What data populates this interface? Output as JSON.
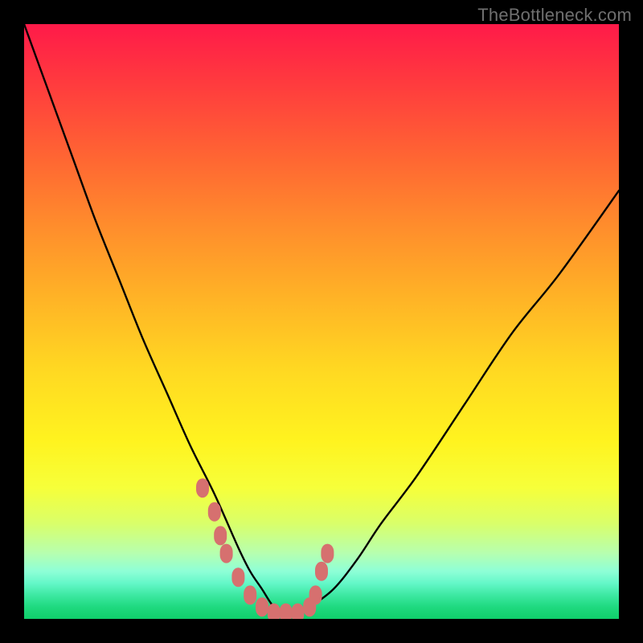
{
  "watermark": "TheBottleneck.com",
  "colors": {
    "page_bg": "#000000",
    "curve": "#000000",
    "marker": "#d6706f",
    "gradient_top": "#ff1a49",
    "gradient_bottom": "#10cf6b"
  },
  "chart_data": {
    "type": "line",
    "title": "",
    "xlabel": "",
    "ylabel": "",
    "xlim": [
      0,
      100
    ],
    "ylim": [
      0,
      100
    ],
    "grid": false,
    "legend": false,
    "series": [
      {
        "name": "bottleneck-curve",
        "x": [
          0,
          4,
          8,
          12,
          16,
          20,
          24,
          28,
          32,
          36,
          38,
          40,
          42,
          44,
          46,
          48,
          52,
          56,
          60,
          66,
          74,
          82,
          90,
          100
        ],
        "y": [
          100,
          89,
          78,
          67,
          57,
          47,
          38,
          29,
          21,
          12,
          8,
          5,
          2,
          1,
          1,
          2,
          5,
          10,
          16,
          24,
          36,
          48,
          58,
          72
        ]
      }
    ],
    "highlight_segments": [
      {
        "name": "left-markers",
        "points": [
          {
            "x": 30,
            "y": 22
          },
          {
            "x": 32,
            "y": 18
          },
          {
            "x": 33,
            "y": 14
          },
          {
            "x": 34,
            "y": 11
          },
          {
            "x": 36,
            "y": 7
          },
          {
            "x": 38,
            "y": 4
          },
          {
            "x": 40,
            "y": 2
          },
          {
            "x": 42,
            "y": 1
          },
          {
            "x": 44,
            "y": 1
          }
        ]
      },
      {
        "name": "right-markers",
        "points": [
          {
            "x": 46,
            "y": 1
          },
          {
            "x": 48,
            "y": 2
          },
          {
            "x": 49,
            "y": 4
          },
          {
            "x": 50,
            "y": 8
          },
          {
            "x": 51,
            "y": 11
          }
        ]
      }
    ]
  }
}
